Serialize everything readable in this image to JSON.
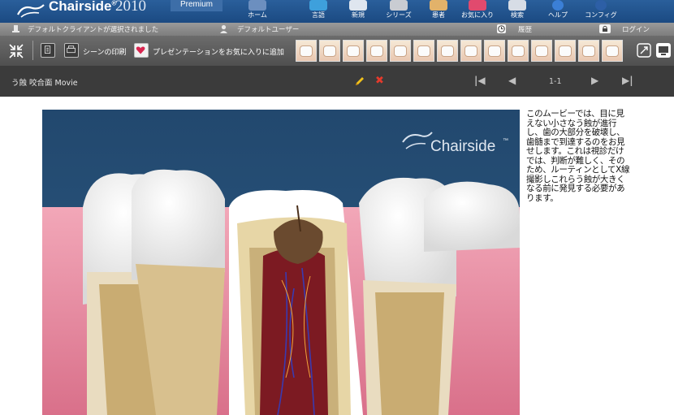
{
  "app": {
    "brand": "Chairside",
    "brand_mark": "®",
    "year": "2010",
    "edition": "Premium"
  },
  "nav": [
    {
      "label": "ホーム",
      "icon": "home-icon"
    },
    {
      "label": "言語",
      "icon": "language-icon"
    },
    {
      "label": "新規",
      "icon": "new-icon"
    },
    {
      "label": "シリーズ",
      "icon": "series-icon"
    },
    {
      "label": "患者",
      "icon": "patient-icon"
    },
    {
      "label": "お気に入り",
      "icon": "favorites-icon"
    },
    {
      "label": "検索",
      "icon": "search-icon"
    },
    {
      "label": "ヘルプ",
      "icon": "help-icon"
    },
    {
      "label": "コンフィグ",
      "icon": "config-icon"
    }
  ],
  "infobar": {
    "client_text": "デフォルトクライアントが選択されました",
    "user_text": "デフォルトユーザー",
    "history_label": "履歴",
    "login_label": "ログイン"
  },
  "toolbar": {
    "print_label": "シーンの印刷",
    "fav_label": "プレゼンテーションをお気に入りに追加",
    "thumb_count": 14
  },
  "titlebar": {
    "title": "う蝕 咬合面 Movie",
    "page_count": "1-1"
  },
  "scene": {
    "watermark": "Chairside",
    "watermark_tm": "™"
  },
  "description": "このムービーでは、目に見えない小さなう蝕が進行し、歯の大部分を破壊し、歯髄まで到達するのをお見せします。これは視診だけでは、判断が難しく、そのため、ルーティンとしてX線撮影しこれらう蝕が大きくなる前に発見する必要があります。",
  "colors": {
    "header_blue": "#1b4a82",
    "scene_bg": "#22486e",
    "gum_pink": "#e78ca0",
    "delete_red": "#e53a2c",
    "edit_yellow": "#f2c21b"
  }
}
